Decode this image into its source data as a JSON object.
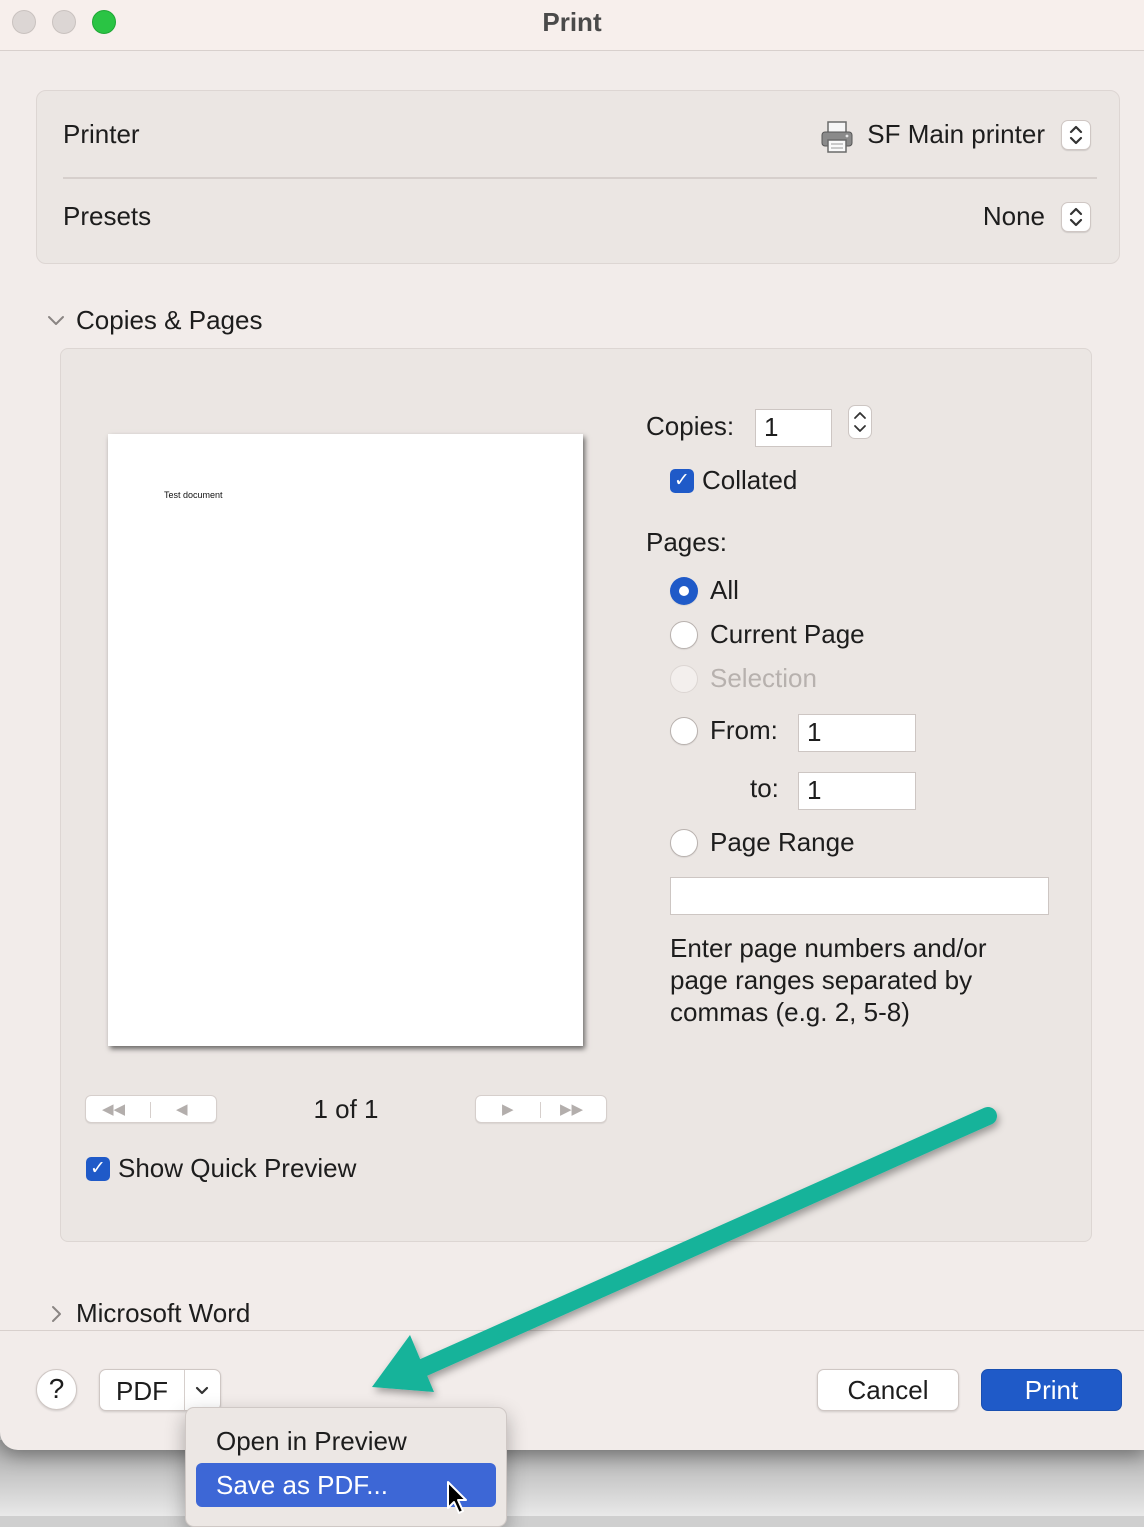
{
  "window": {
    "title": "Print"
  },
  "printer": {
    "label": "Printer",
    "value": "SF Main printer"
  },
  "presets": {
    "label": "Presets",
    "value": "None"
  },
  "copies_pages": {
    "section_title": "Copies & Pages",
    "preview_text": "Test document",
    "page_indicator": "1 of 1",
    "show_quick_preview": "Show Quick Preview",
    "copies_label": "Copies:",
    "copies_value": "1",
    "collated_label": "Collated",
    "pages_label": "Pages:",
    "options": {
      "all": "All",
      "current": "Current Page",
      "selection": "Selection",
      "from": "From:",
      "to": "to:",
      "range": "Page Range"
    },
    "from_value": "1",
    "to_value": "1",
    "range_value": "",
    "hint": "Enter page numbers and/or page ranges separated by commas (e.g. 2, 5-8)"
  },
  "microsoft_word": {
    "section_title": "Microsoft Word"
  },
  "footer": {
    "help": "?",
    "pdf": "PDF",
    "cancel": "Cancel",
    "print": "Print"
  },
  "pdf_menu": {
    "items": [
      "Open in Preview",
      "Save as PDF..."
    ],
    "selected_item": "Save as PDF..."
  },
  "colors": {
    "accent": "#1f5ac8",
    "menu_selection": "#3d67d6",
    "annotation_arrow": "#13b39a",
    "window_background": "#f2ecea"
  },
  "icons": [
    "printer-icon",
    "stepper-icon",
    "chevron-down-icon",
    "chevron-right-icon",
    "first-page-icon",
    "previous-page-icon",
    "next-page-icon",
    "last-page-icon",
    "checkmark-icon",
    "mouse-cursor-icon",
    "annotation-arrow"
  ]
}
